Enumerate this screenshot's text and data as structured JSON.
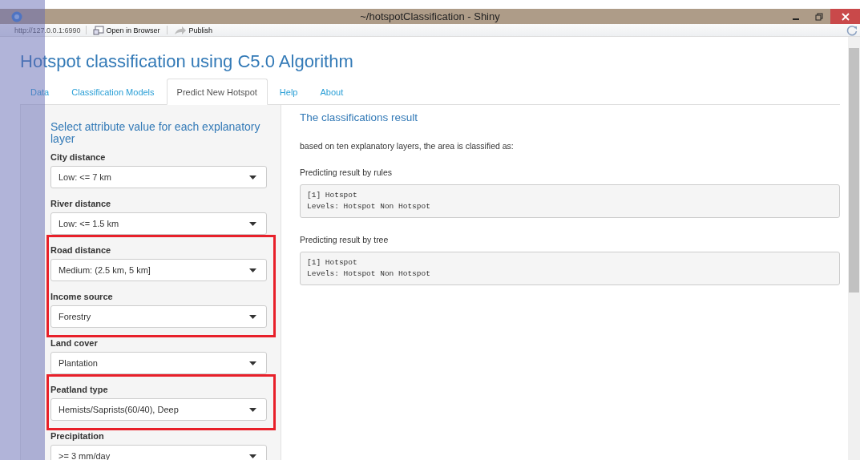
{
  "window": {
    "title": "~/hotspotClassification - Shiny"
  },
  "toolbar": {
    "url": "http://127.0.0.1:6990",
    "buttons": [
      "Open in Browser",
      "Publish"
    ]
  },
  "page_title": "Hotspot classification using C5.0 Algorithm",
  "tabs": [
    {
      "label": "Data",
      "selected": false
    },
    {
      "label": "Classification Models",
      "selected": false
    },
    {
      "label": "Predict New Hotspot",
      "selected": true
    },
    {
      "label": "Help",
      "selected": false
    },
    {
      "label": "About",
      "selected": false
    }
  ],
  "sidebar": {
    "heading": "Select attribute value for each explanatory layer",
    "field_groups": [
      {
        "highlighted": false,
        "fields": [
          {
            "label": "City distance",
            "value": "Low: <= 7 km"
          },
          {
            "label": "River distance",
            "value": "Low: <= 1.5 km"
          }
        ]
      },
      {
        "highlighted": true,
        "fields": [
          {
            "label": "Road distance",
            "value": "Medium: (2.5 km, 5 km]"
          },
          {
            "label": "Income source",
            "value": "Forestry"
          }
        ]
      },
      {
        "highlighted": false,
        "fields": [
          {
            "label": "Land cover",
            "value": "Plantation"
          }
        ]
      },
      {
        "highlighted": true,
        "fields": [
          {
            "label": "Peatland type",
            "value": "Hemists/Saprists(60/40), Deep"
          }
        ]
      },
      {
        "highlighted": false,
        "fields": [
          {
            "label": "Precipitation",
            "value": ">= 3 mm/day"
          }
        ]
      }
    ]
  },
  "main": {
    "heading": "The classifications result",
    "intro": "based on ten explanatory layers, the area is classified as:",
    "results": [
      {
        "label": "Predicting result by rules",
        "lines": [
          "[1] Hotspot",
          "Levels: Hotspot Non Hotspot"
        ]
      },
      {
        "label": "Predicting result by tree",
        "lines": [
          "[1] Hotspot",
          "Levels: Hotspot Non Hotspot"
        ]
      }
    ]
  }
}
